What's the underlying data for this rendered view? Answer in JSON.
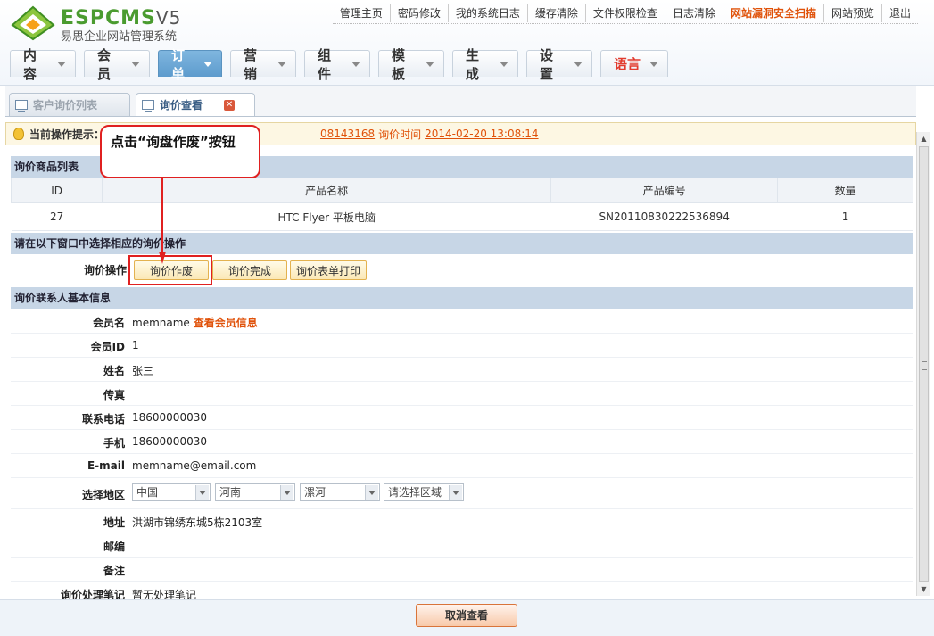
{
  "header": {
    "logo_text": "ESPCMS",
    "logo_version": "V5",
    "logo_subtitle": "易思企业网站管理系统",
    "top_links": [
      {
        "label": "管理主页",
        "hot": false
      },
      {
        "label": "密码修改",
        "hot": false
      },
      {
        "label": "我的系统日志",
        "hot": false
      },
      {
        "label": "缓存清除",
        "hot": false
      },
      {
        "label": "文件权限检查",
        "hot": false
      },
      {
        "label": "日志清除",
        "hot": false
      },
      {
        "label": "网站漏洞安全扫描",
        "hot": true
      },
      {
        "label": "网站预览",
        "hot": false
      },
      {
        "label": "退出",
        "hot": false
      }
    ],
    "main_tabs": [
      {
        "label": "内容"
      },
      {
        "label": "会员"
      },
      {
        "label": "订单",
        "active": true
      },
      {
        "label": "营销"
      },
      {
        "label": "组件"
      },
      {
        "label": "模板"
      },
      {
        "label": "生成"
      },
      {
        "label": "设置"
      },
      {
        "label": "语言",
        "red": true
      }
    ]
  },
  "subtabs": [
    {
      "label": "客户询价列表",
      "active": false
    },
    {
      "label": "询价查看",
      "active": true
    }
  ],
  "tip": {
    "label": "当前操作提示：",
    "order_no_partial": "08143168",
    "time_label": "询价时间",
    "time_value": "2014-02-20 13:08:14"
  },
  "products": {
    "title": "询价商品列表",
    "columns": [
      "ID",
      "产品名称",
      "产品编号",
      "数量"
    ],
    "rows": [
      [
        "27",
        "HTC Flyer 平板电脑",
        "SN20110830222536894",
        "1"
      ]
    ]
  },
  "operation": {
    "title": "请在以下窗口中选择相应的询价操作",
    "label": "询价操作",
    "buttons": [
      "询价作废",
      "询价完成",
      "询价表单打印"
    ]
  },
  "contact": {
    "title": "询价联系人基本信息",
    "member_name_label": "会员名",
    "member_name": "memname",
    "member_link": "查看会员信息",
    "member_id_label": "会员ID",
    "member_id": "1",
    "name_label": "姓名",
    "name": "张三",
    "fax_label": "传真",
    "fax": "",
    "phone_label": "联系电话",
    "phone": "18600000030",
    "mobile_label": "手机",
    "mobile": "18600000030",
    "email_label": "E-mail",
    "email": "memname@email.com",
    "region_label": "选择地区",
    "region": [
      "中国",
      "河南",
      "漯河",
      "请选择区域"
    ],
    "address_label": "地址",
    "address": "洪湖市锦绣东城5栋2103室",
    "postcode_label": "邮编",
    "postcode": "",
    "remark_label": "备注",
    "remark": "",
    "notes_label": "询价处理笔记",
    "notes": "暂无处理笔记"
  },
  "footer": {
    "cancel_label": "取消查看"
  },
  "callout": {
    "text": "点击“询盘作废”按钮"
  },
  "colors": {
    "accent": "#e0520a",
    "highlight": "#e02020",
    "section": "#c7d6e6",
    "active_tab": "#5d9bcd"
  }
}
